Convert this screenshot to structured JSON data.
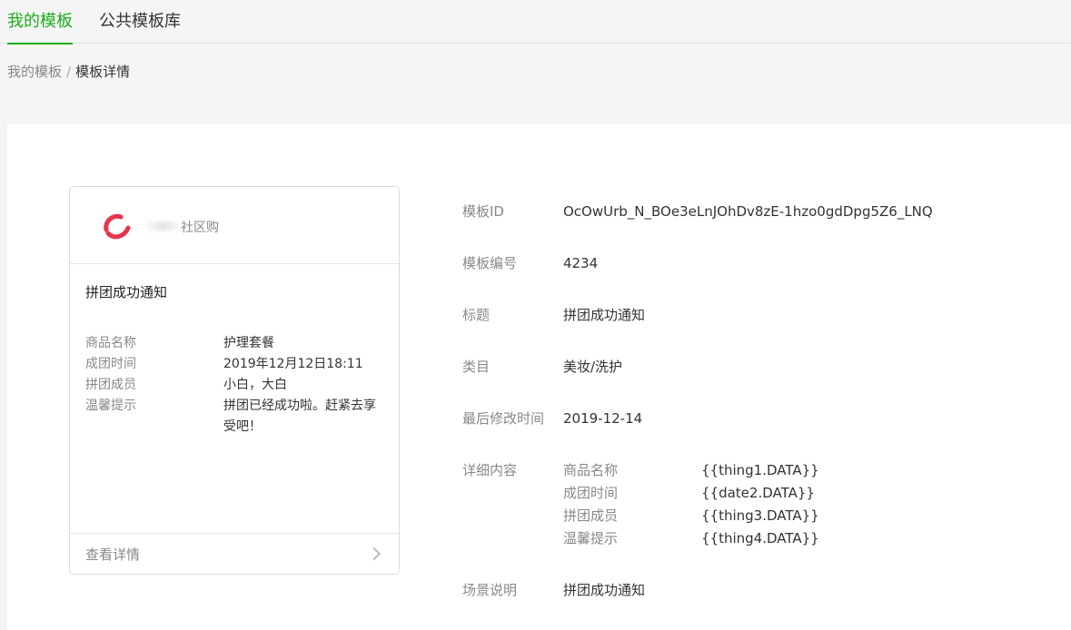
{
  "tabs": [
    {
      "label": "我的模板",
      "active": true
    },
    {
      "label": "公共模板库",
      "active": false
    }
  ],
  "breadcrumb": {
    "parent": "我的模板",
    "separator": "/",
    "current": "模板详情"
  },
  "preview": {
    "brand_suffix": "社区购",
    "title": "拼团成功通知",
    "fields": [
      {
        "label": "商品名称",
        "value": "护理套餐"
      },
      {
        "label": "成团时间",
        "value": "2019年12月12日18:11"
      },
      {
        "label": "拼团成员",
        "value": "小白，大白"
      },
      {
        "label": "温馨提示",
        "value": "拼团已经成功啦。赶紧去享受吧！"
      }
    ],
    "footer_label": "查看详情"
  },
  "details": {
    "template_id": {
      "label": "模板ID",
      "value": "OcOwUrb_N_BOe3eLnJOhDv8zE-1hzo0gdDpg5Z6_LNQ"
    },
    "template_no": {
      "label": "模板编号",
      "value": "4234"
    },
    "title": {
      "label": "标题",
      "value": "拼团成功通知"
    },
    "category": {
      "label": "类目",
      "value": "美妆/洗护"
    },
    "modified": {
      "label": "最后修改时间",
      "value": "2019-12-14"
    },
    "content": {
      "label": "详细内容",
      "rows": [
        {
          "name": "商品名称",
          "key": "{{thing1.DATA}}"
        },
        {
          "name": "成团时间",
          "key": "{{date2.DATA}}"
        },
        {
          "name": "拼团成员",
          "key": "{{thing3.DATA}}"
        },
        {
          "name": "温馨提示",
          "key": "{{thing4.DATA}}"
        }
      ]
    },
    "scene": {
      "label": "场景说明",
      "value": "拼团成功通知"
    }
  },
  "colors": {
    "accent": "#1aad19",
    "logo": "#e8344e"
  }
}
